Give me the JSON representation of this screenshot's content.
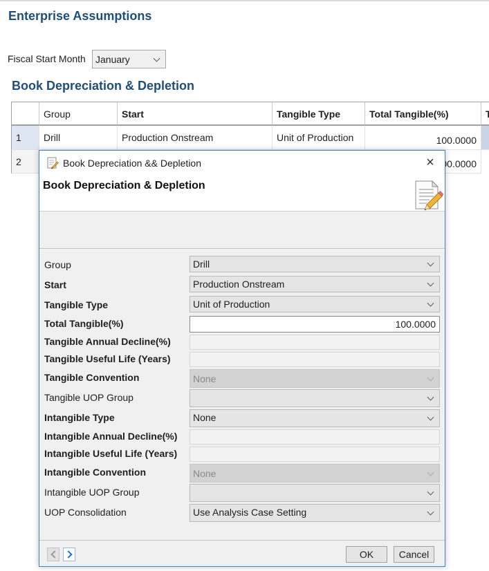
{
  "page": {
    "title": "Enterprise Assumptions",
    "fiscal_label": "Fiscal Start Month",
    "fiscal_value": "January",
    "section_title": "Book Depreciation & Depletion"
  },
  "grid": {
    "headers": [
      "Group",
      "Start",
      "Tangible Type",
      "Total Tangible(%)",
      "T"
    ],
    "rows": [
      {
        "num": "1",
        "group": "Drill",
        "start": "Production Onstream",
        "tangible_type": "Unit of Production",
        "total_tangible": "100.0000"
      },
      {
        "num": "2",
        "total_tangible_partial": "00.0000"
      }
    ]
  },
  "dialog": {
    "window_title": "Book Depreciation && Depletion",
    "close_glyph": "×",
    "banner_title": "Book Depreciation & Depletion",
    "fields": [
      {
        "label": "Group",
        "value": "Drill"
      },
      {
        "label": "Start",
        "value": "Production Onstream"
      },
      {
        "label": "Tangible Type",
        "value": "Unit of Production"
      },
      {
        "label": "Total Tangible(%)",
        "value": "100.0000"
      },
      {
        "label": "Tangible Annual Decline(%)",
        "value": ""
      },
      {
        "label": "Tangible Useful Life (Years)",
        "value": ""
      },
      {
        "label": "Tangible Convention",
        "value": "None"
      },
      {
        "label": "Tangible UOP Group",
        "value": ""
      },
      {
        "label": "Intangible Type",
        "value": "None"
      },
      {
        "label": "Intangible Annual Decline(%)",
        "value": ""
      },
      {
        "label": "Intangible Useful Life  (Years)",
        "value": ""
      },
      {
        "label": "Intangible Convention",
        "value": "None"
      },
      {
        "label": "Intangible UOP Group",
        "value": ""
      },
      {
        "label": "UOP Consolidation",
        "value": "Use Analysis Case Setting"
      }
    ],
    "ok_label": "OK",
    "cancel_label": "Cancel"
  },
  "colors": {
    "heading": "#1f4e79",
    "dialog_border": "#3e86c8",
    "nav_arrow": "#1f6fd0"
  }
}
